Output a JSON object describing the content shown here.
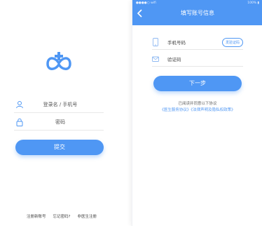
{
  "login": {
    "username_placeholder": "登录名 / 手机号",
    "password_placeholder": "密码",
    "submit_label": "提交",
    "links": [
      "注册新账号",
      "忘记密码?",
      "非医生注册"
    ]
  },
  "register": {
    "status_left": "●●●●○ wifi",
    "status_right": "100% ▮",
    "title": "填写账号信息",
    "phone_placeholder": "手机号码",
    "code_button": "发验证码",
    "code_placeholder": "验证码",
    "next_label": "下一步",
    "agree_text": "已阅读并同意以下协议",
    "agree_links": "《医生服务协议》《法律声明及隐私权政策》"
  },
  "colors": {
    "primary": "#4f97f4"
  },
  "icons": {
    "logo": "double-heart-plus-logo",
    "user": "user-icon",
    "lock": "lock-icon",
    "phone": "phone-icon",
    "message": "message-icon",
    "back": "chevron-left-icon"
  }
}
